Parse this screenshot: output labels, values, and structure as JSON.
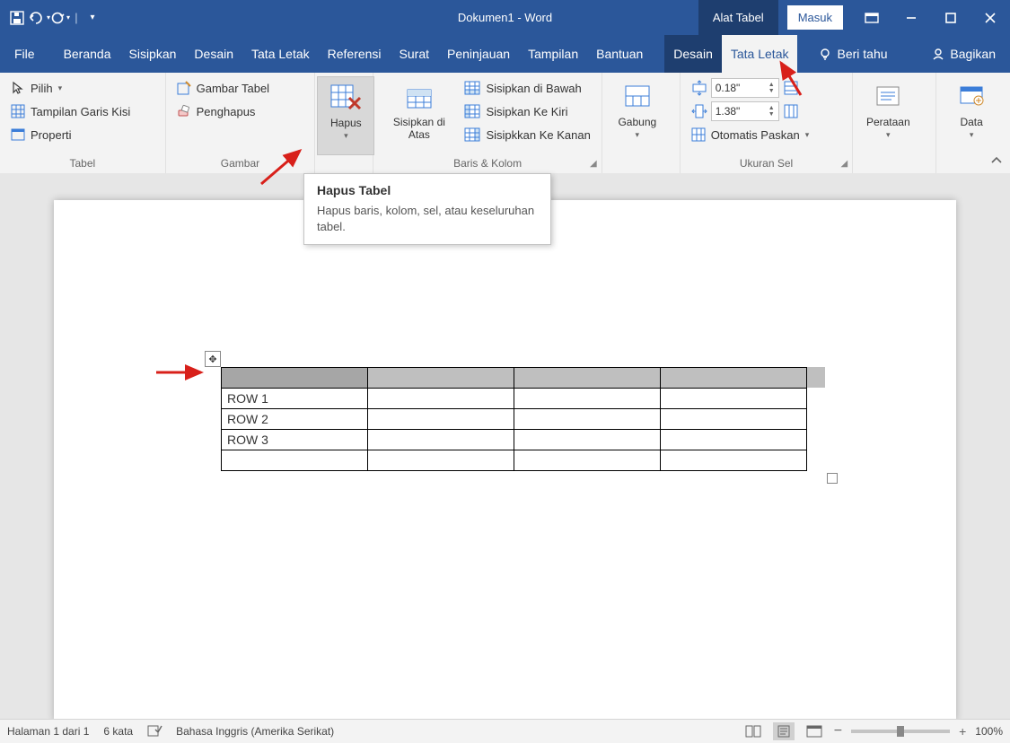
{
  "titlebar": {
    "title": "Dokumen1  -  Word",
    "context_tab": "Alat Tabel",
    "signin": "Masuk"
  },
  "tabs": {
    "file": "File",
    "beranda": "Beranda",
    "sisipkan": "Sisipkan",
    "desain": "Desain",
    "tata_letak": "Tata Letak",
    "referensi": "Referensi",
    "surat": "Surat",
    "peninjauan": "Peninjauan",
    "tampilan": "Tampilan",
    "bantuan": "Bantuan",
    "tbl_desain": "Desain",
    "tbl_tata_letak": "Tata Letak",
    "tell_me": "Beri tahu",
    "bagikan": "Bagikan"
  },
  "ribbon": {
    "tabel": {
      "pilih": "Pilih",
      "tampilan_garis": "Tampilan Garis Kisi",
      "properti": "Properti",
      "label": "Tabel"
    },
    "gambar": {
      "gambar_tabel": "Gambar Tabel",
      "penghapus": "Penghapus",
      "label": "Gambar"
    },
    "hapus": {
      "label": "Hapus"
    },
    "sisip": {
      "atas": "Sisipkan di Atas",
      "bawah": "Sisipkan di Bawah",
      "kiri": "Sisipkan Ke Kiri",
      "kanan": "Sisipkkan Ke Kanan",
      "label": "Baris & Kolom"
    },
    "gabung": {
      "label": "Gabung"
    },
    "ukuran": {
      "height": "0.18\"",
      "width": "1.38\"",
      "autofit": "Otomatis Paskan",
      "label": "Ukuran Sel"
    },
    "perataan": {
      "label": "Perataan"
    },
    "data": {
      "label": "Data"
    }
  },
  "tooltip": {
    "title": "Hapus Tabel",
    "body": "Hapus baris, kolom, sel, atau keseluruhan tabel."
  },
  "table_rows": [
    "ROW 1",
    "ROW 2",
    "ROW 3"
  ],
  "status": {
    "page": "Halaman 1 dari 1",
    "words": "6 kata",
    "lang": "Bahasa Inggris (Amerika Serikat)",
    "zoom": "100%"
  }
}
